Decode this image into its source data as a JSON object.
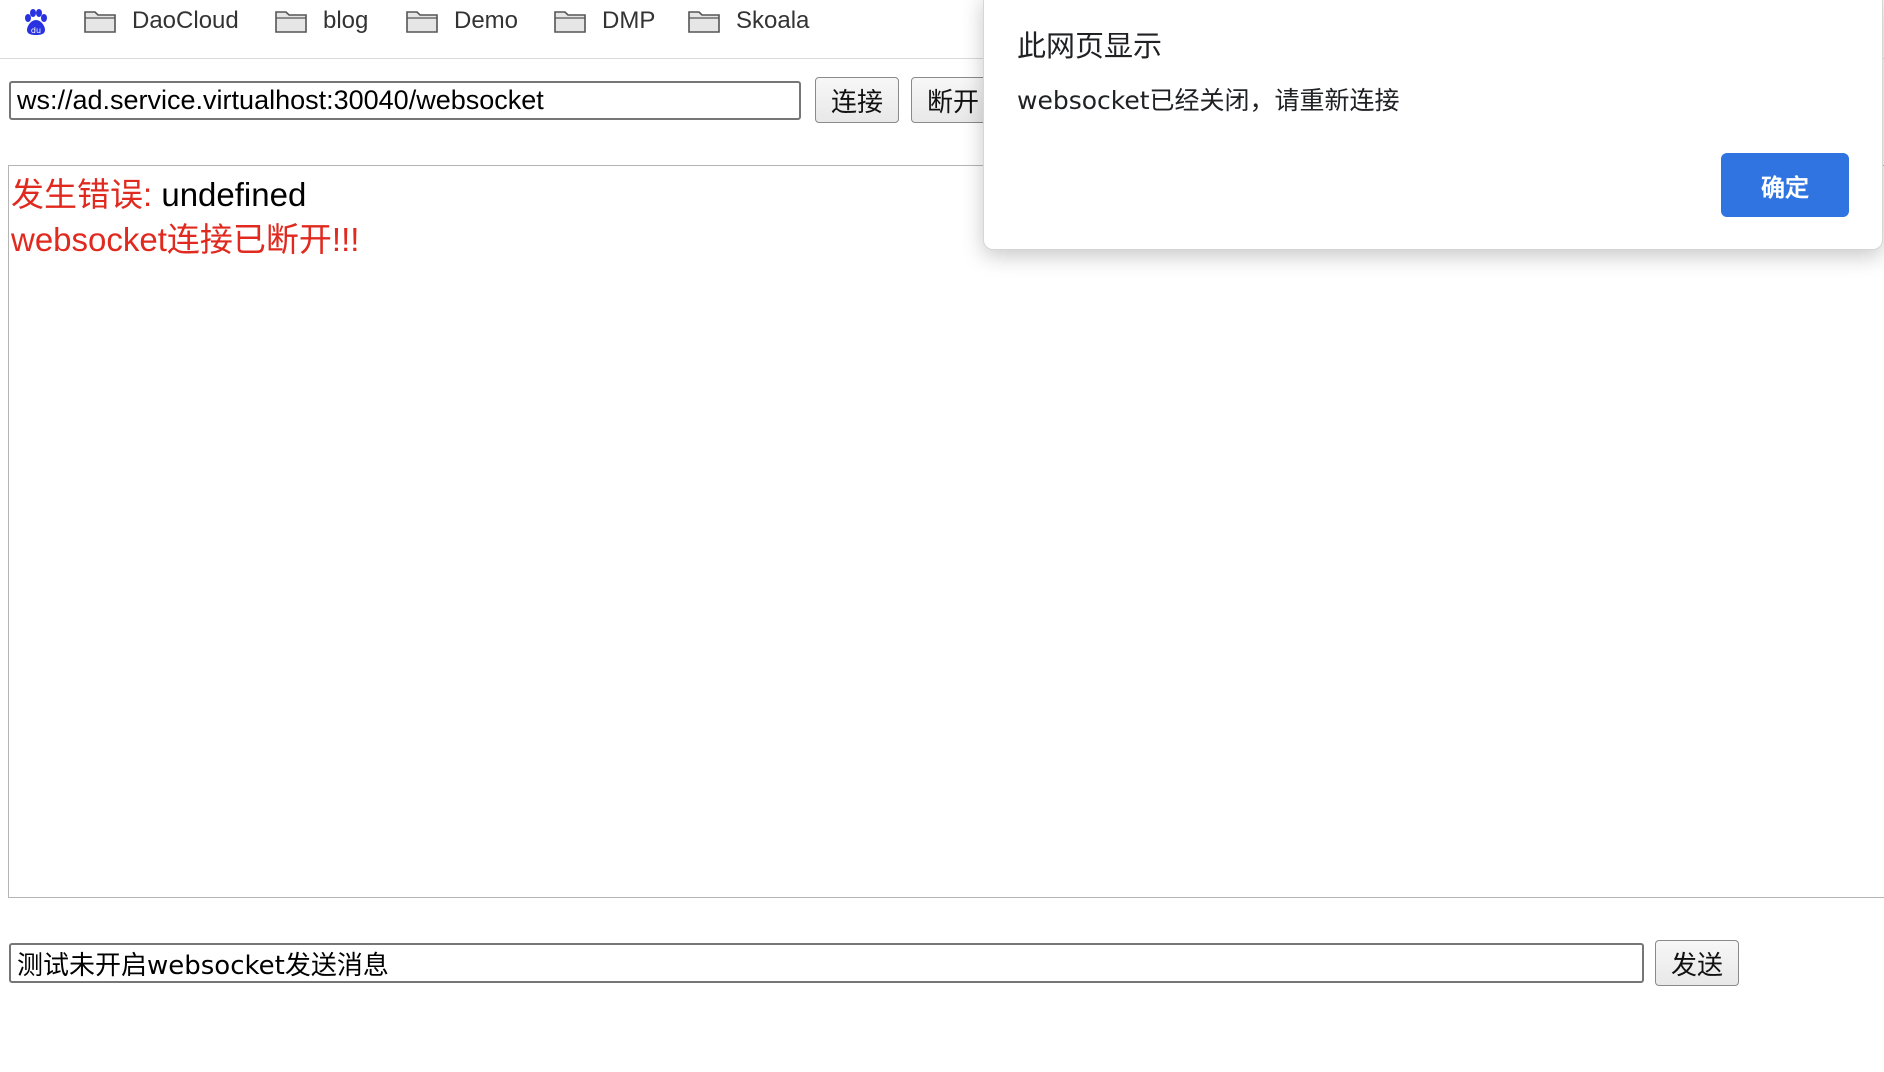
{
  "bookmarks": {
    "items": [
      {
        "label": "DaoCloud"
      },
      {
        "label": "blog"
      },
      {
        "label": "Demo"
      },
      {
        "label": "DMP"
      },
      {
        "label": "Skoala"
      }
    ],
    "colors": {
      "logo": "#2932e1",
      "folder_fill": "#e6e6e6",
      "folder_stroke": "#555555"
    }
  },
  "connection": {
    "url_value": "ws://ad.service.virtualhost:30040/websocket",
    "connect_label": "连接",
    "disconnect_label": "断开"
  },
  "log": {
    "lines": [
      {
        "prefix": "发生错误: ",
        "value": "undefined"
      },
      {
        "text": "websocket连接已断开!!!"
      }
    ],
    "colors": {
      "error": "#e02a1f"
    }
  },
  "send": {
    "message_value": "测试未开启websocket发送消息",
    "send_label": "发送"
  },
  "alert": {
    "title": "此网页显示",
    "message": "websocket已经关闭，请重新连接",
    "ok_label": "确定",
    "colors": {
      "ok_button": "#2f74e0"
    }
  }
}
